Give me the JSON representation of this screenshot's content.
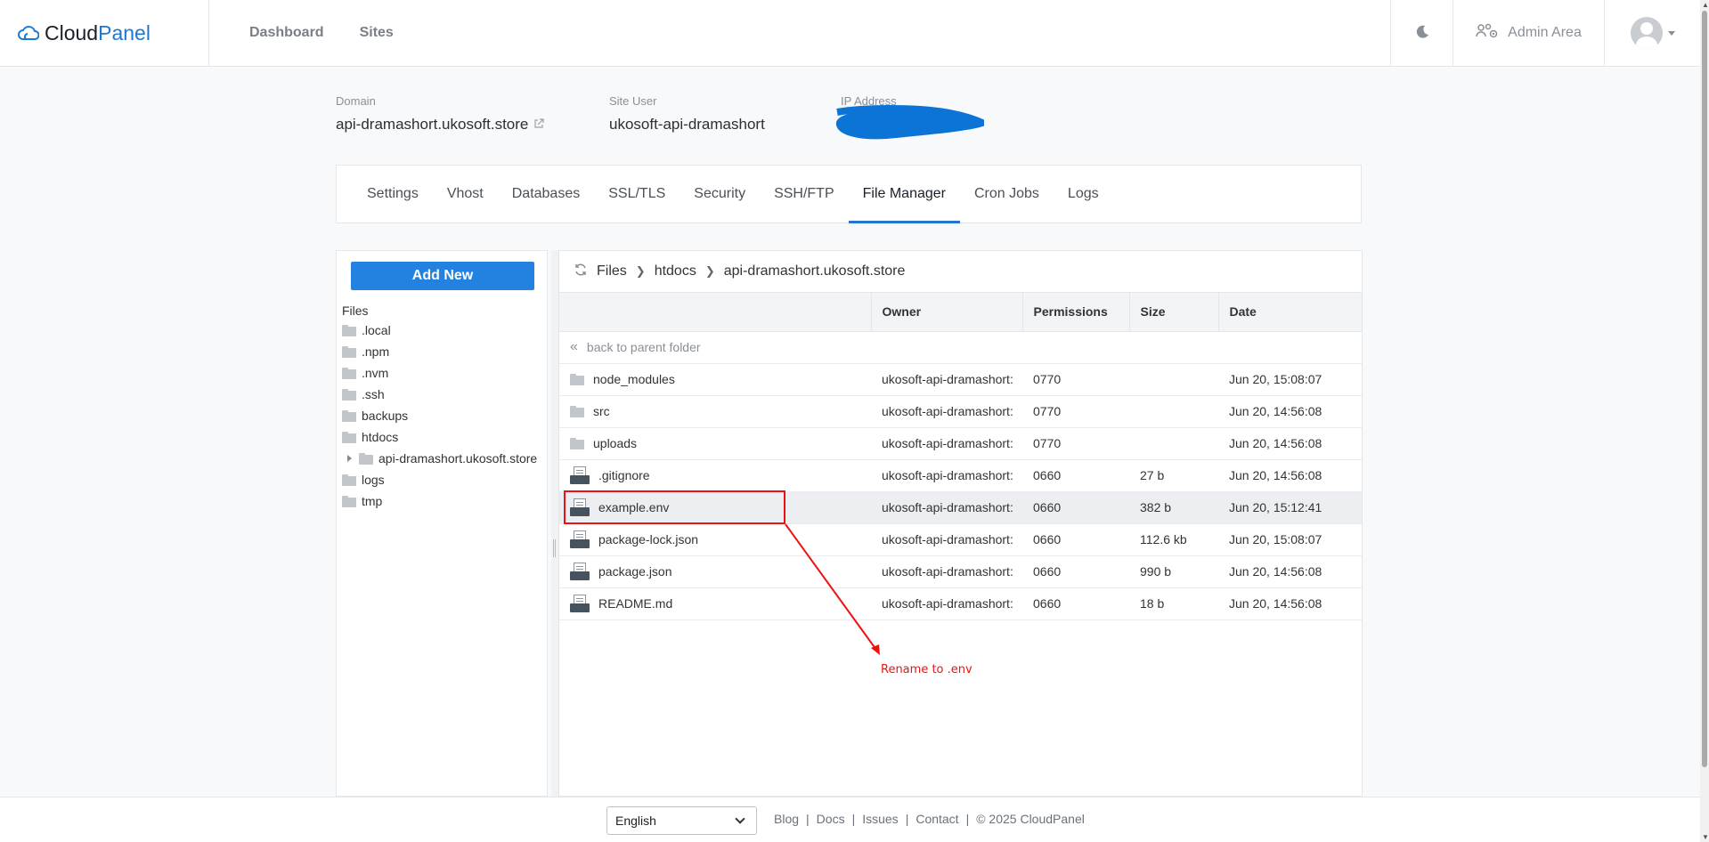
{
  "header": {
    "brand_main": "Cloud",
    "brand_accent": "Panel",
    "nav": [
      "Dashboard",
      "Sites"
    ],
    "admin_label": "Admin Area"
  },
  "site": {
    "domain_label": "Domain",
    "domain_value": "api-dramashort.ukosoft.store",
    "user_label": "Site User",
    "user_value": "ukosoft-api-dramashort",
    "ip_label": "IP Address"
  },
  "tabs": [
    "Settings",
    "Vhost",
    "Databases",
    "SSL/TLS",
    "Security",
    "SSH/FTP",
    "File Manager",
    "Cron Jobs",
    "Logs"
  ],
  "active_tab": "File Manager",
  "file_manager": {
    "add_new_label": "Add New",
    "tree_root": "Files",
    "tree": [
      ".local",
      ".npm",
      ".nvm",
      ".ssh",
      "backups",
      "htdocs",
      "api-dramashort.ukosoft.store",
      "logs",
      "tmp"
    ],
    "breadcrumb": [
      "Files",
      "htdocs",
      "api-dramashort.ukosoft.store"
    ],
    "columns": [
      "",
      "Owner",
      "Permissions",
      "Size",
      "Date"
    ],
    "parent_label": "back to parent folder",
    "rows": [
      {
        "name": "node_modules",
        "type": "folder",
        "owner": "ukosoft-api-dramashort:",
        "perm": "0770",
        "size": "",
        "date": "Jun 20, 15:08:07"
      },
      {
        "name": "src",
        "type": "folder",
        "owner": "ukosoft-api-dramashort:",
        "perm": "0770",
        "size": "",
        "date": "Jun 20, 14:56:08"
      },
      {
        "name": "uploads",
        "type": "folder",
        "owner": "ukosoft-api-dramashort:",
        "perm": "0770",
        "size": "",
        "date": "Jun 20, 14:56:08"
      },
      {
        "name": ".gitignore",
        "type": "file",
        "owner": "ukosoft-api-dramashort:",
        "perm": "0660",
        "size": "27 b",
        "date": "Jun 20, 14:56:08"
      },
      {
        "name": "example.env",
        "type": "file",
        "owner": "ukosoft-api-dramashort:",
        "perm": "0660",
        "size": "382 b",
        "date": "Jun 20, 15:12:41"
      },
      {
        "name": "package-lock.json",
        "type": "file",
        "owner": "ukosoft-api-dramashort:",
        "perm": "0660",
        "size": "112.6 kb",
        "date": "Jun 20, 15:08:07"
      },
      {
        "name": "package.json",
        "type": "file",
        "owner": "ukosoft-api-dramashort:",
        "perm": "0660",
        "size": "990 b",
        "date": "Jun 20, 14:56:08"
      },
      {
        "name": "README.md",
        "type": "file",
        "owner": "ukosoft-api-dramashort:",
        "perm": "0660",
        "size": "18 b",
        "date": "Jun 20, 14:56:08"
      }
    ],
    "selected_row": "example.env"
  },
  "annotation": "Rename to .env",
  "footer": {
    "language": "English",
    "links": [
      "Blog",
      "Docs",
      "Issues",
      "Contact"
    ],
    "copyright": "© 2025  CloudPanel"
  },
  "colors": {
    "accent": "#2381e0",
    "annotation": "#ee1111",
    "redaction": "#0b74d6"
  }
}
